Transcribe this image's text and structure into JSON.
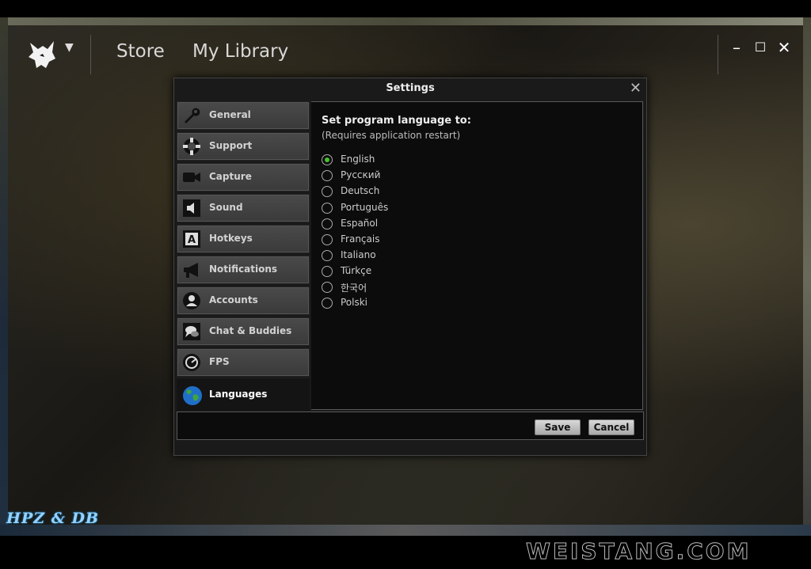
{
  "nav": {
    "store": "Store",
    "library": "My Library"
  },
  "window": {
    "minimize": "–",
    "maximize": "☐",
    "close": "✕"
  },
  "dialog": {
    "title": "Settings",
    "close": "✕",
    "sidebar": [
      {
        "label": "General",
        "icon": "wrench-icon"
      },
      {
        "label": "Support",
        "icon": "lifebuoy-icon"
      },
      {
        "label": "Capture",
        "icon": "camera-icon"
      },
      {
        "label": "Sound",
        "icon": "speaker-icon"
      },
      {
        "label": "Hotkeys",
        "icon": "keyboard-key-icon"
      },
      {
        "label": "Notifications",
        "icon": "megaphone-icon"
      },
      {
        "label": "Accounts",
        "icon": "user-icon"
      },
      {
        "label": "Chat & Buddies",
        "icon": "chat-icon"
      },
      {
        "label": "FPS",
        "icon": "gauge-icon"
      },
      {
        "label": "Languages",
        "icon": "globe-icon",
        "active": true
      }
    ],
    "content": {
      "heading": "Set program language to:",
      "note": "(Requires application restart)",
      "selected": "English",
      "languages": [
        "English",
        "Русский",
        "Deutsch",
        "Português",
        "Español",
        "Français",
        "Italiano",
        "Türkçe",
        "한국어",
        "Polski"
      ]
    },
    "footer": {
      "save": "Save",
      "cancel": "Cancel"
    }
  },
  "watermarks": {
    "left": "HPZ & DB",
    "right": "WEISTANG.COM"
  },
  "colors": {
    "radio_checked": "#47c22f",
    "dialog_bg": "#1a1a1a"
  }
}
